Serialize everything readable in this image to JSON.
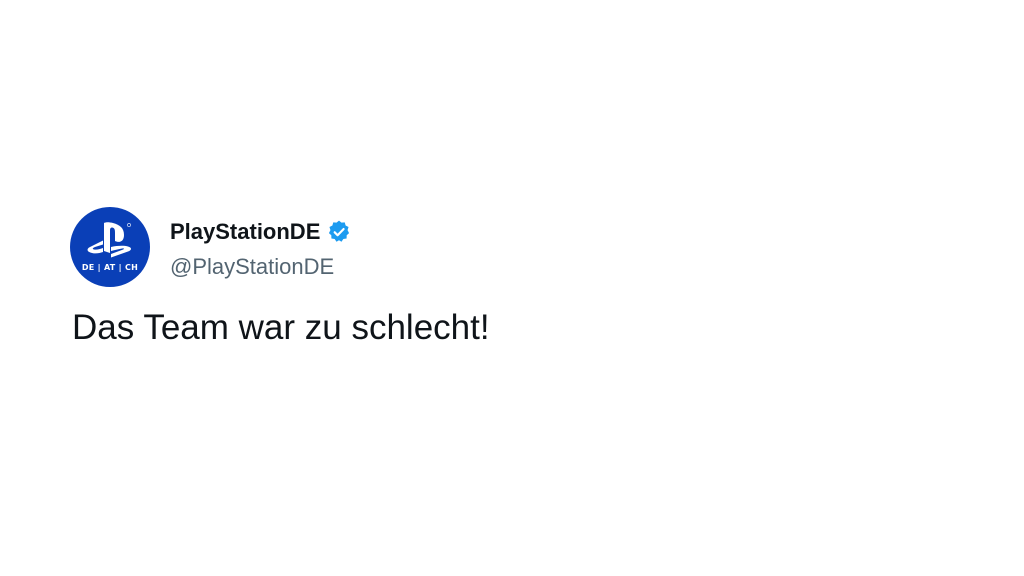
{
  "tweet": {
    "author": {
      "display_name": "PlayStationDE",
      "handle": "@PlayStationDE",
      "verified": true,
      "avatar": {
        "logo": "playstation-logo",
        "region_text": "DE | AT | CH",
        "background_color": "#0a3fb7"
      }
    },
    "text": "Das Team war zu schlecht!"
  },
  "colors": {
    "verified_badge": "#1d9bf0",
    "primary_text": "#0f1419",
    "secondary_text": "#536471"
  }
}
